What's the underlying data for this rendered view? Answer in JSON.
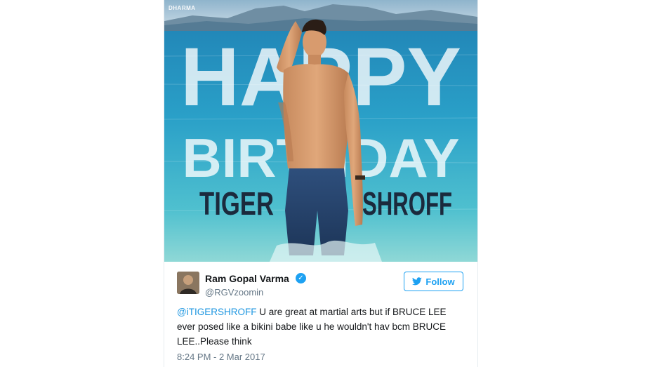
{
  "image": {
    "brand": "DHARMA",
    "headline_line1": "HAPPY",
    "headline_line2": "BIRTHDAY",
    "subject_name_left": "TIGER",
    "subject_name_right": "SHROFF"
  },
  "tweet": {
    "display_name": "Ram Gopal Varma",
    "handle": "@RGVzoomin",
    "verified_icon": "verified-badge-icon",
    "follow_label": "Follow",
    "follow_icon": "twitter-bird-icon",
    "mention": "@iTIGERSHROFF",
    "body": " U are great at martial arts but if BRUCE LEE ever posed like a bikini babe like u he wouldn't hav bcm BRUCE LEE..Please think",
    "timestamp": "8:24 PM - 2 Mar 2017"
  },
  "colors": {
    "accent": "#1da1f2",
    "mention": "#1b95e0",
    "secondary_text": "#657786",
    "primary_text": "#14171a",
    "sea": "#2aa0c8",
    "name_text": "#1b2a3d"
  }
}
